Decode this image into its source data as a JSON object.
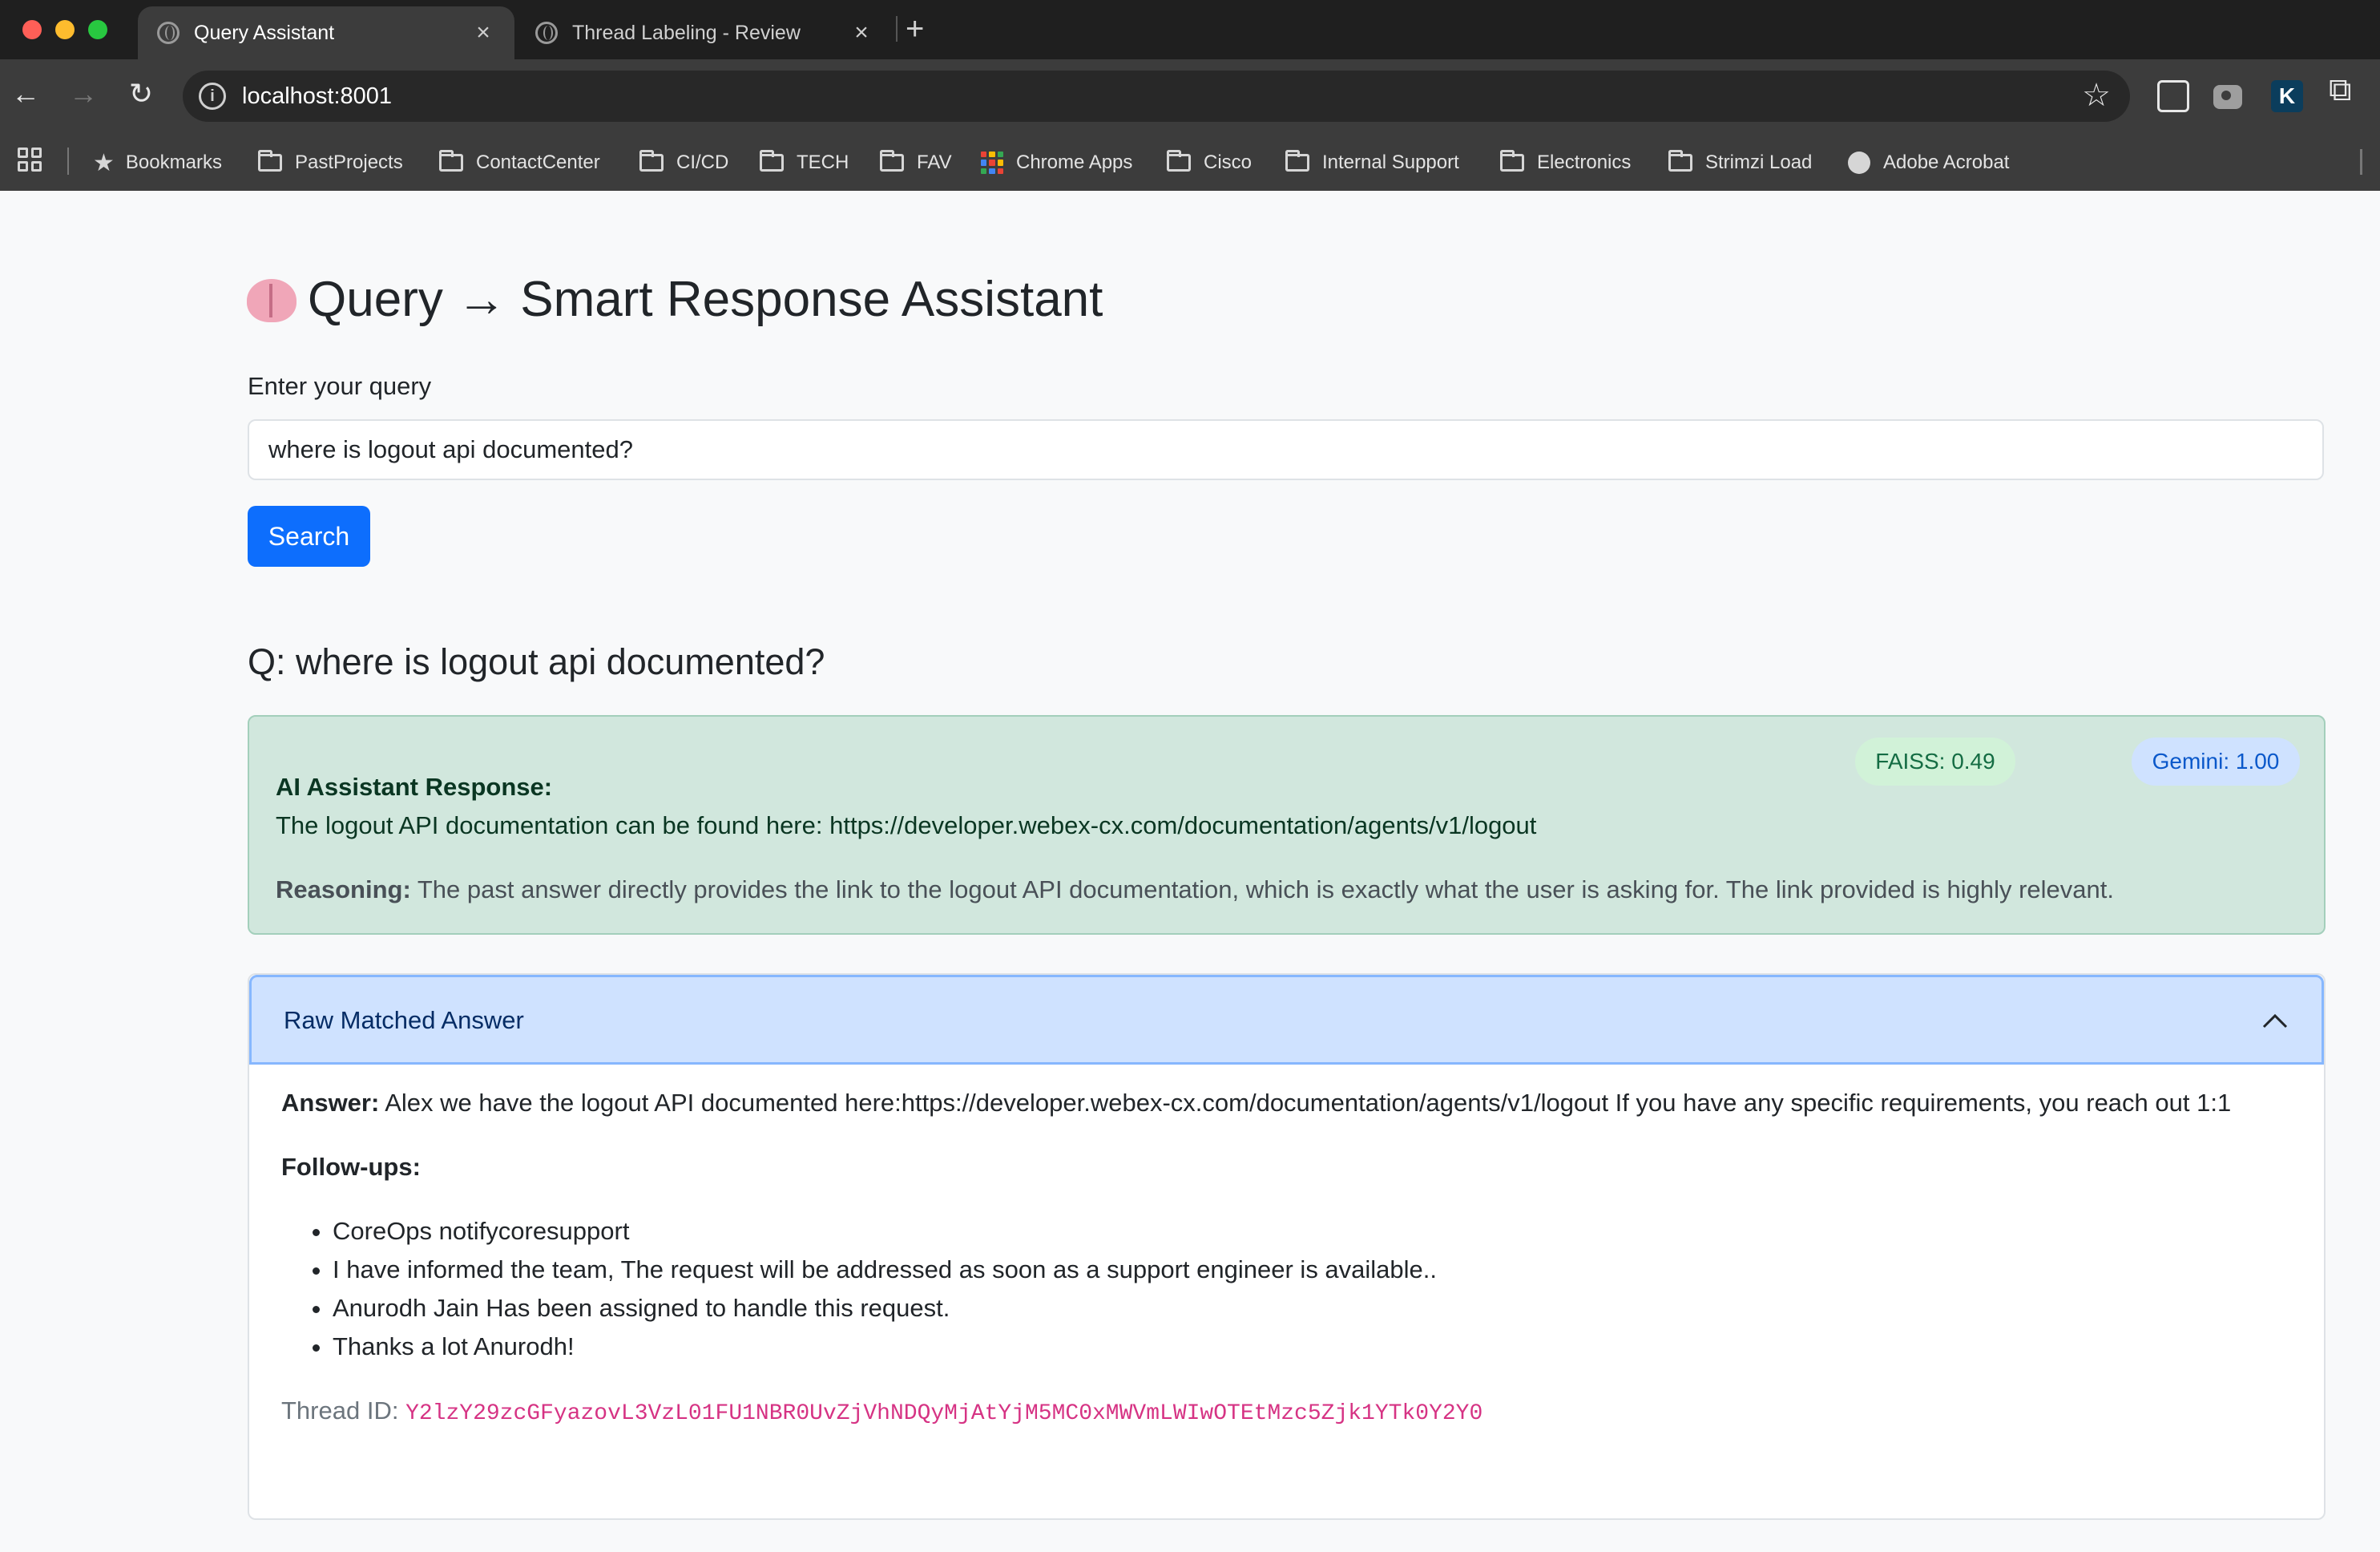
{
  "browser": {
    "tabs": [
      {
        "title": "Query Assistant",
        "active": true
      },
      {
        "title": "Thread Labeling - Review",
        "active": false
      }
    ],
    "url": "localhost:8001",
    "bookmarks": [
      {
        "label": "Bookmarks",
        "icon": "star-icon"
      },
      {
        "label": "PastProjects",
        "icon": "folder-icon"
      },
      {
        "label": "ContactCenter",
        "icon": "folder-icon"
      },
      {
        "label": "CI/CD",
        "icon": "folder-icon"
      },
      {
        "label": "TECH",
        "icon": "folder-icon"
      },
      {
        "label": "FAV",
        "icon": "folder-icon"
      },
      {
        "label": "Chrome Apps",
        "icon": "apps-grid-icon"
      },
      {
        "label": "Cisco",
        "icon": "folder-icon"
      },
      {
        "label": "Internal Support",
        "icon": "folder-icon"
      },
      {
        "label": "Electronics",
        "icon": "folder-icon"
      },
      {
        "label": "Strimzi Load",
        "icon": "folder-icon"
      },
      {
        "label": "Adobe Acrobat",
        "icon": "globe-icon"
      }
    ]
  },
  "page": {
    "title": "Query → Smart Response Assistant",
    "title_icon": "brain-emoji",
    "query_label": "Enter your query",
    "query_value": "where is logout api documented?",
    "search_label": "Search",
    "question_heading": "Q: where is logout api documented?"
  },
  "response": {
    "faiss_badge": "FAISS: 0.49",
    "gemini_badge": "Gemini: 1.00",
    "heading": "AI Assistant Response:",
    "text": "The logout API documentation can be found here: https://developer.webex-cx.com/documentation/agents/v1/logout",
    "reasoning_label": "Reasoning:",
    "reasoning_text": " The past answer directly provides the link to the logout API documentation, which is exactly what the user is asking for. The link provided is highly relevant.",
    "colors": {
      "success_bg": "#d1e7dd",
      "primary": "#0d6efd"
    }
  },
  "raw_match": {
    "title": "Raw Matched Answer",
    "answer_label": "Answer:",
    "answer_text": " Alex we have the logout API documented here:https://developer.webex-cx.com/documentation/agents/v1/logout If you have any specific requirements, you reach out 1:1",
    "followups_label": "Follow-ups:",
    "followups": [
      "CoreOps notifycoresupport",
      "I have informed the team, The request will be addressed as soon as a support engineer is available..",
      "Anurodh Jain Has been assigned to handle this request.",
      "Thanks a lot Anurodh!"
    ],
    "thread_label": "Thread ID: ",
    "thread_id": "Y2lzY29zcGFyazovL3VzL01FU1NBR0UvZjVhNDQyMjAtYjM5MC0xMWVmLWIwOTEtMzc5Zjk1YTk0Y2Y0"
  }
}
